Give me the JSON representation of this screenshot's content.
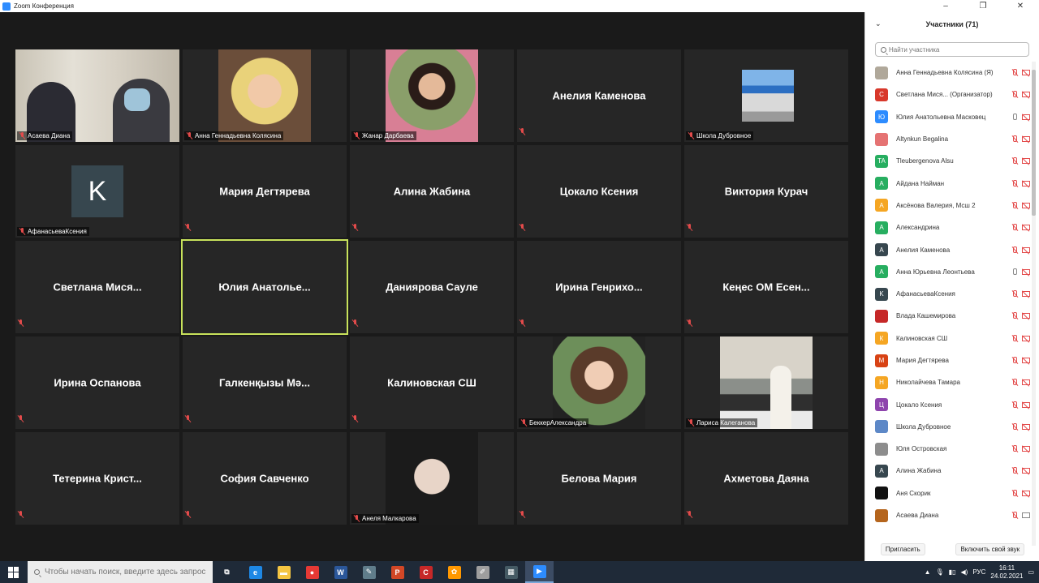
{
  "window": {
    "title": "Zoom Конференция",
    "minimize": "‒",
    "maximize": "❐",
    "close": "✕"
  },
  "tiles": [
    {
      "name": "Асаева Диана"
    },
    {
      "name": "Анна Геннадьевна Колясина"
    },
    {
      "name": "Жанар Дарбаева"
    },
    {
      "name": "Анелия Каменова"
    },
    {
      "name": "Школа Дубровное"
    },
    {
      "name": "АфанасьеваКсения",
      "avatar_letter": "K"
    },
    {
      "name": "Мария Дегтярева"
    },
    {
      "name": "Алина Жабина"
    },
    {
      "name": "Цокало Ксения"
    },
    {
      "name": "Виктория Курач"
    },
    {
      "name": "Светлана Мися..."
    },
    {
      "name": "Юлия Анатолье..."
    },
    {
      "name": "Даниярова Сауле"
    },
    {
      "name": "Ирина Генрихо..."
    },
    {
      "name": "Кеңес ОМ Есен..."
    },
    {
      "name": "Ирина Оспанова"
    },
    {
      "name": "Галкенқызы Мә..."
    },
    {
      "name": "Калиновская СШ"
    },
    {
      "name": "БеккерАлександра"
    },
    {
      "name": "Лариса Калеганова"
    },
    {
      "name": "Тетерина Крист..."
    },
    {
      "name": "София Савченко"
    },
    {
      "name": "Анеля Малкарова"
    },
    {
      "name": "Белова Мария"
    },
    {
      "name": "Ахметова Даяна"
    }
  ],
  "panel": {
    "title": "Участники (71)",
    "collapse_icon": "⌄",
    "search_placeholder": "Найти участника",
    "participants": [
      {
        "name": "Анна Геннадьевна Колясина (Я)",
        "avatar": "",
        "color": "#b0a89a",
        "mic": "muted",
        "cam": "off"
      },
      {
        "name": "Светлана Мися...  (Организатор)",
        "avatar": "С",
        "color": "#d8382b",
        "mic": "muted",
        "cam": "off"
      },
      {
        "name": "Юлия Анатольевна  Масковец",
        "avatar": "Ю",
        "color": "#2d8cff",
        "mic": "on",
        "cam": "off"
      },
      {
        "name": "Altynkun Begalina",
        "avatar": "",
        "color": "#e57373",
        "mic": "muted",
        "cam": "off"
      },
      {
        "name": "Tleubergenova Alsu",
        "avatar": "TA",
        "color": "#27ae60",
        "mic": "muted",
        "cam": "off"
      },
      {
        "name": "Айдана Найман",
        "avatar": "А",
        "color": "#27ae60",
        "mic": "muted",
        "cam": "off"
      },
      {
        "name": "Аксёнова Валерия, Мсш 2",
        "avatar": "А",
        "color": "#f5a623",
        "mic": "muted",
        "cam": "off"
      },
      {
        "name": "Александрина",
        "avatar": "А",
        "color": "#27ae60",
        "mic": "muted",
        "cam": "off"
      },
      {
        "name": "Анелия Каменова",
        "avatar": "А",
        "color": "#37474f",
        "mic": "muted",
        "cam": "off"
      },
      {
        "name": "Анна Юрьевна Леонтьева",
        "avatar": "А",
        "color": "#27ae60",
        "mic": "on",
        "cam": "off"
      },
      {
        "name": "АфанасьеваКсения",
        "avatar": "K",
        "color": "#37474f",
        "mic": "muted",
        "cam": "off"
      },
      {
        "name": "Влада Кашемирова",
        "avatar": "",
        "color": "#c62828",
        "mic": "muted",
        "cam": "off"
      },
      {
        "name": "Калиновская СШ",
        "avatar": "К",
        "color": "#f5a623",
        "mic": "muted",
        "cam": "off"
      },
      {
        "name": "Мария Дегтярева",
        "avatar": "М",
        "color": "#d84315",
        "mic": "muted",
        "cam": "off"
      },
      {
        "name": "Николайчева Тамара",
        "avatar": "Н",
        "color": "#f5a623",
        "mic": "muted",
        "cam": "off"
      },
      {
        "name": "Цокало Ксения",
        "avatar": "Ц",
        "color": "#8e44ad",
        "mic": "muted",
        "cam": "off"
      },
      {
        "name": "Школа Дубровное",
        "avatar": "",
        "color": "#5d88c7",
        "mic": "muted",
        "cam": "off"
      },
      {
        "name": "Юля Островская",
        "avatar": "",
        "color": "#8d8d8d",
        "mic": "muted",
        "cam": "off"
      },
      {
        "name": "Алина Жабина",
        "avatar": "А",
        "color": "#37474f",
        "mic": "muted",
        "cam": "off"
      },
      {
        "name": "Аня Скорик",
        "avatar": "",
        "color": "#111111",
        "mic": "muted",
        "cam": "off"
      },
      {
        "name": "Асаева Диана",
        "avatar": "",
        "color": "#b5651d",
        "mic": "muted",
        "cam": "on"
      }
    ],
    "invite_button": "Пригласить",
    "unmute_button": "Включить свой звук"
  },
  "taskbar": {
    "search_placeholder": "Чтобы начать поиск, введите здесь запрос",
    "apps": [
      {
        "name": "task-view",
        "label": "⧉",
        "color": "transparent"
      },
      {
        "name": "edge",
        "label": "e",
        "color": "#1e88e5"
      },
      {
        "name": "explorer",
        "label": "▬",
        "color": "#f4c542"
      },
      {
        "name": "chrome",
        "label": "●",
        "color": "#e53935"
      },
      {
        "name": "word",
        "label": "W",
        "color": "#2b579a"
      },
      {
        "name": "paint",
        "label": "✎",
        "color": "#607d8b"
      },
      {
        "name": "powerpoint",
        "label": "P",
        "color": "#d24726"
      },
      {
        "name": "app-red",
        "label": "C",
        "color": "#c62828"
      },
      {
        "name": "app-orange",
        "label": "✿",
        "color": "#ff9800"
      },
      {
        "name": "app-pen",
        "label": "✐",
        "color": "#9e9e9e"
      },
      {
        "name": "calculator",
        "label": "▦",
        "color": "#455a64"
      },
      {
        "name": "zoom",
        "label": "▶",
        "color": "#2d8cff"
      }
    ],
    "lang": "РУС",
    "time": "16:11",
    "date": "24.02.2021"
  }
}
